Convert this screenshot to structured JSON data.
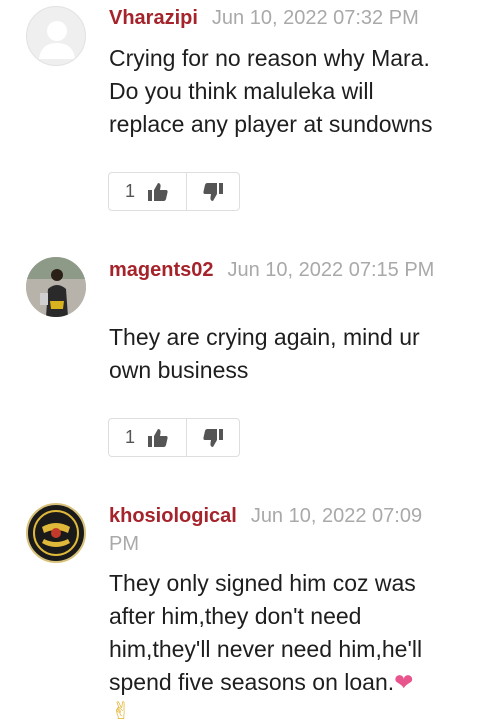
{
  "comments": [
    {
      "author": "Vharazipi",
      "time": "Jun 10, 2022 07:32 PM",
      "text": "Crying for no reason why Mara. Do you think maluleka will replace any player at sundowns",
      "likes": "1",
      "avatar_icon": "default-user-icon"
    },
    {
      "author": "magents02",
      "time": "Jun 10, 2022 07:15 PM",
      "text": "They are crying again, mind ur own business",
      "likes": "1",
      "avatar_icon": "user-photo"
    },
    {
      "author": "khosiological",
      "time": "Jun 10, 2022 07:09 PM",
      "text": "They only signed him coz was after him,they don't need him,they'll never need him,he'll spend five seasons on loan.",
      "emoji_heart": "❤",
      "emoji_peace": "✌",
      "avatar_logo_text": "KAIZER CHIEFS"
    }
  ],
  "colors": {
    "author": "#a5232b",
    "time": "#a9a9a9",
    "heart": "#e8558c"
  }
}
